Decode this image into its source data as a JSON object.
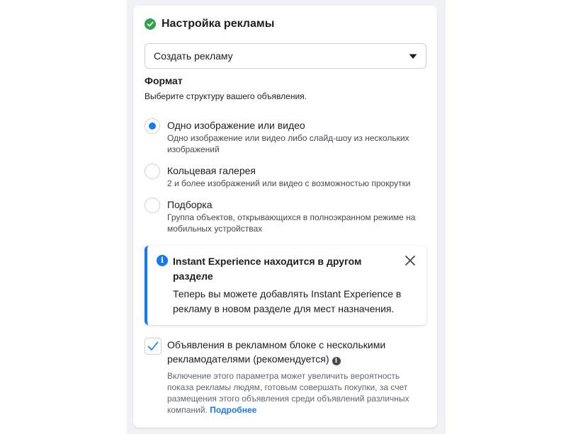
{
  "header": {
    "title": "Настройка рекламы",
    "status_icon": "check-circle-icon",
    "status_color": "#31a24c"
  },
  "ad_select": {
    "value": "Создать рекламу",
    "icon": "caret-down-icon"
  },
  "format": {
    "title": "Формат",
    "subtitle": "Выберите структуру вашего объявления.",
    "options": [
      {
        "label": "Одно изображение или видео",
        "description": "Одно изображение или видео либо слайд-шоу из нескольких изображений",
        "selected": true
      },
      {
        "label": "Кольцевая галерея",
        "description": "2 и более изображений или видео с возможностью прокрутки",
        "selected": false
      },
      {
        "label": "Подборка",
        "description": "Группа объектов, открывающихся в полноэкранном режиме на мобильных устройствах",
        "selected": false
      }
    ]
  },
  "notice": {
    "title": "Instant Experience находится в другом разделе",
    "body": "Теперь вы можете добавлять Instant Experience в рекламу в новом разделе для мест назначения.",
    "accent_color": "#1877f2",
    "icon": "info-icon",
    "close_icon": "close-icon"
  },
  "multi_advertiser": {
    "checked": true,
    "label": "Объявления в рекламном блоке с несколькими рекламодателями (рекомендуется)",
    "description": "Включение этого параметра может увеличить вероятность показа рекламы людям, готовым совершать покупки, за счет размещения этого объявления среди объявлений различных компаний.",
    "link_text": "Подробнее"
  },
  "colors": {
    "accent": "#1877f2",
    "page_background": "#f0f2f5"
  }
}
